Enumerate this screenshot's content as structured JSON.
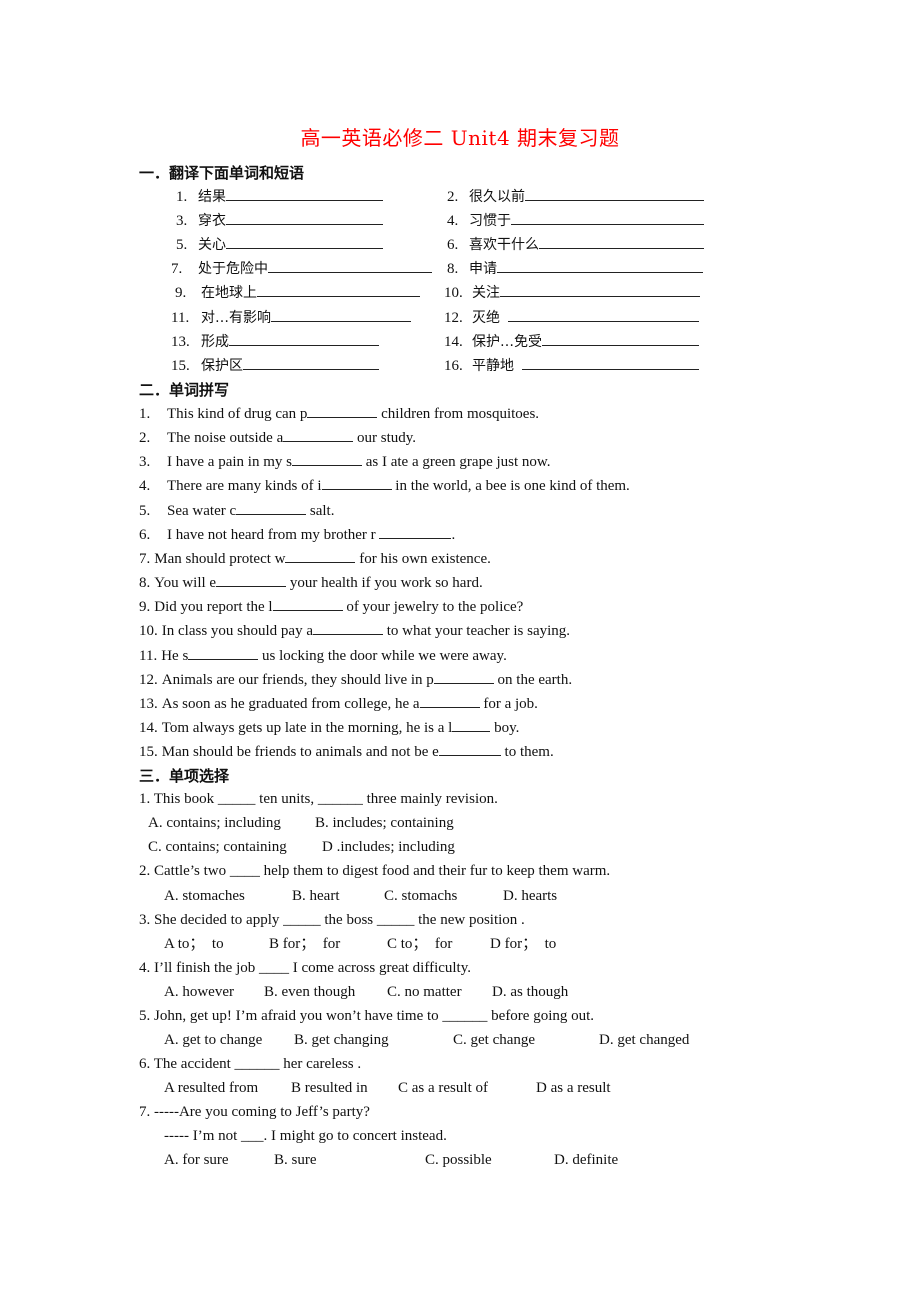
{
  "document": {
    "title": "高一英语必修二 Unit4 期末复习题",
    "title_color": "#ff0000"
  },
  "section1": {
    "heading": "一．翻译下面单词和短语",
    "items": [
      {
        "num": "1.",
        "text": "结果"
      },
      {
        "num": "2.",
        "text": "很久以前"
      },
      {
        "num": "3.",
        "text": "穿衣"
      },
      {
        "num": "4.",
        "text": "习惯于"
      },
      {
        "num": "5.",
        "text": "关心"
      },
      {
        "num": "6.",
        "text": "喜欢干什么"
      },
      {
        "num": "7.",
        "text": "处于危险中"
      },
      {
        "num": "8.",
        "text": "申请"
      },
      {
        "num": "9.",
        "text": "在地球上"
      },
      {
        "num": "10.",
        "text": "关注"
      },
      {
        "num": "11.",
        "text": "对…有影响"
      },
      {
        "num": "12.",
        "text": "灭绝"
      },
      {
        "num": "13.",
        "text": "形成"
      },
      {
        "num": "14.",
        "text": "保护…免受"
      },
      {
        "num": "15.",
        "text": "保护区"
      },
      {
        "num": "16.",
        "text": "平静地"
      }
    ]
  },
  "section2": {
    "heading": "二．单词拼写",
    "items": [
      {
        "num": "1.",
        "before": "This kind of drug can p",
        "after": " children from mosquitoes."
      },
      {
        "num": "2.",
        "before": "The noise outside a",
        "after": " our study."
      },
      {
        "num": "3.",
        "before": "I have a pain in my s",
        "after": " as I ate a green grape just now."
      },
      {
        "num": "4.",
        "before": "There are many kinds of i",
        "after": " in the world, a bee is one kind of them."
      },
      {
        "num": "5.",
        "before": "Sea water c",
        "after": " salt."
      },
      {
        "num": "6.",
        "before": "I have not heard from my brother r ",
        "after": "."
      },
      {
        "num": "7.",
        "before": "Man should protect w",
        "after": " for his own existence."
      },
      {
        "num": "8.",
        "before": "You will e",
        "after": " your health if you work so hard."
      },
      {
        "num": "9.",
        "before": "Did you report the l",
        "after": " of your jewelry to the police?"
      },
      {
        "num": "10.",
        "before": "In class you should pay a",
        "after": " to what your teacher is saying."
      },
      {
        "num": "11.",
        "before": "He s",
        "after": " us locking the door while we were away."
      },
      {
        "num": "12.",
        "before": "Animals are our friends, they should live in p",
        "after": " on the earth."
      },
      {
        "num": "13.",
        "before": "As soon as he graduated from college, he a",
        "after": " for a job."
      },
      {
        "num": "14.",
        "before": "Tom always gets up late in the morning, he is a l",
        "after": " boy."
      },
      {
        "num": "15.",
        "before": "Man should be friends to animals and not be e",
        "after": " to them."
      }
    ]
  },
  "section3": {
    "heading": "三．单项选择",
    "questions": [
      {
        "stem": "1. This book _____ ten units, ______ three mainly revision.",
        "options": [
          "A. contains; including",
          "B. includes; containing",
          "C. contains; containing",
          "D .includes; including"
        ]
      },
      {
        "stem": "2. Cattle’s two ____ help them to digest food and their fur to keep them warm.",
        "options": [
          "A. stomaches",
          "B. heart",
          "C. stomachs",
          "D. hearts"
        ]
      },
      {
        "stem": "3. She decided to apply _____ the boss _____ the new position .",
        "options": [
          "A to；  to",
          "B for；  for",
          "C to；  for",
          "D for；  to"
        ]
      },
      {
        "stem": "4. I’ll finish the job ____ I come across great difficulty.",
        "options": [
          "A. however",
          "B. even though",
          "C. no matter",
          "D. as though"
        ]
      },
      {
        "stem": "5. John, get up! I’m afraid you won’t have time to ______ before going out.",
        "options": [
          "A. get to change",
          "B. get changing",
          "C. get change",
          "D. get changed"
        ]
      },
      {
        "stem": "6. The accident ______ her careless .",
        "options": [
          "A resulted from",
          "B resulted in",
          "C as a result of",
          "D as a result"
        ]
      },
      {
        "stem": "7. -----Are you coming to Jeff’s party?",
        "stem2": "----- I’m not ___. I might go to concert instead.",
        "options": [
          "A. for sure",
          "B. sure",
          "C. possible",
          "D. definite"
        ]
      }
    ]
  }
}
